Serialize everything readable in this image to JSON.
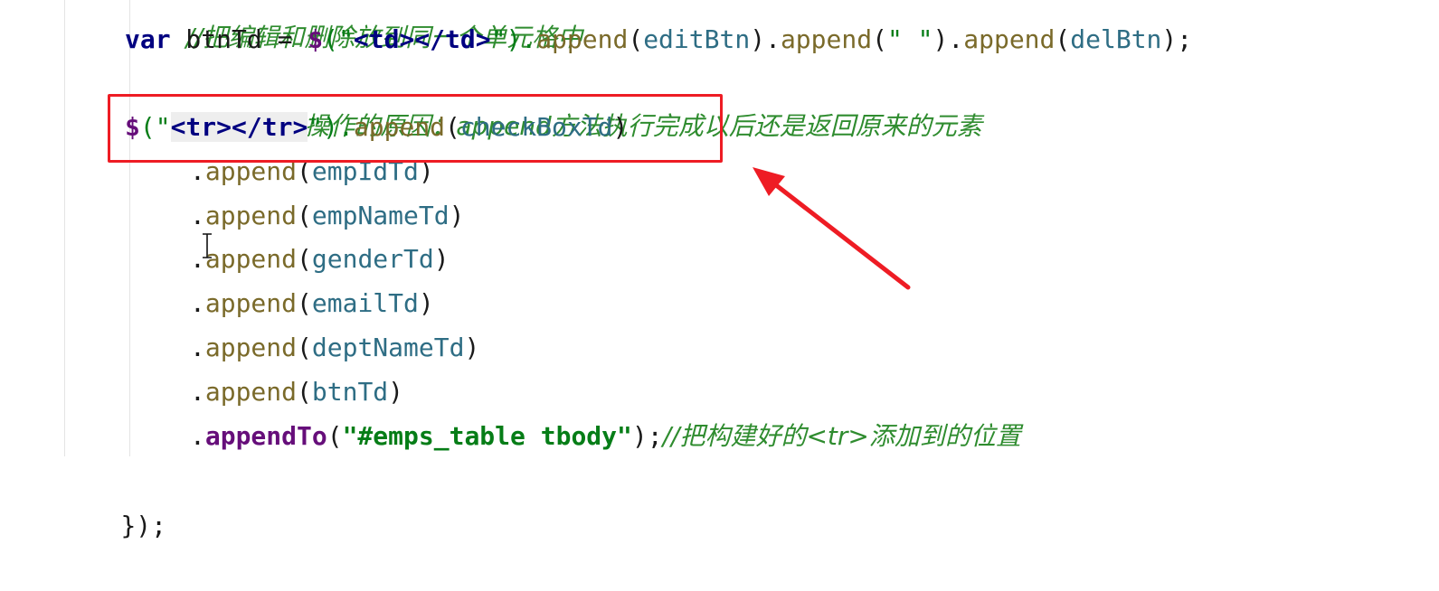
{
  "code": {
    "line0_comment": "//把编辑和删除放到同一个单元格中",
    "line1": {
      "kw": "var",
      "varname": " btnTd = ",
      "dollar": "$",
      "open": "(\"",
      "td_open": "<td>",
      "td_close": "</td>",
      "close": "\").",
      "fn1": "append",
      "arg1": "editBtn",
      "fn2": "append",
      "str2": "\" \"",
      "fn3": "append",
      "arg3": "delBtn",
      "end": ");"
    },
    "line2_comment": "//可以链式操作的原因：append方法执行完成以后还是返回原来的元素",
    "line3": {
      "dollar": "$",
      "open": "(\"",
      "tr_open": "<tr>",
      "tr_close": "</tr>",
      "close": "\").",
      "fn": "append",
      "arg": "checkBoxTd"
    },
    "chain": [
      {
        "fn": "append",
        "arg": "empIdTd"
      },
      {
        "fn": "append",
        "arg": "empNameTd"
      },
      {
        "fn": "append",
        "arg": "genderTd"
      },
      {
        "fn": "append",
        "arg": "emailTd"
      },
      {
        "fn": "append",
        "arg": "deptNameTd"
      },
      {
        "fn": "append",
        "arg": "btnTd"
      }
    ],
    "last": {
      "fn": "appendTo",
      "str": "\"#emps_table tbody\"",
      "end": ");",
      "comment": "//把构建好的<tr>添加到的位置"
    },
    "closing": "});"
  },
  "annotation": {
    "highlight_color": "#ee1c24",
    "arrow_color": "#ee1c24"
  }
}
